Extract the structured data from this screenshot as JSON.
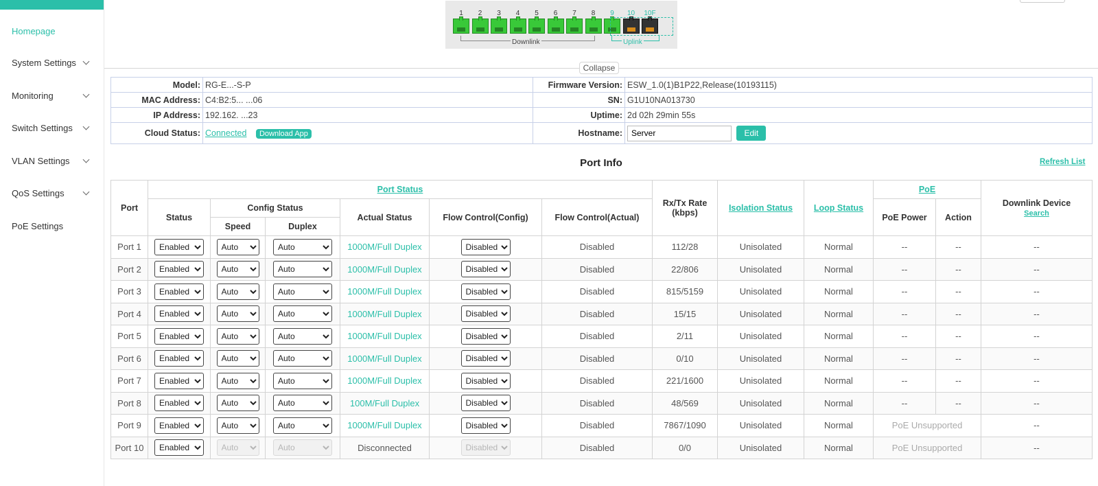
{
  "sidebar": {
    "items": [
      {
        "label": "Homepage",
        "active": true,
        "expandable": false
      },
      {
        "label": "System Settings",
        "expandable": true
      },
      {
        "label": "Monitoring",
        "expandable": true
      },
      {
        "label": "Switch Settings",
        "expandable": true
      },
      {
        "label": "VLAN Settings",
        "expandable": true
      },
      {
        "label": "QoS Settings",
        "expandable": true
      },
      {
        "label": "PoE Settings",
        "expandable": false
      }
    ]
  },
  "panel": {
    "port_numbers": [
      "1",
      "2",
      "3",
      "4",
      "5",
      "6",
      "7",
      "8",
      "9",
      "10",
      "10F"
    ],
    "downlink_label": "Downlink",
    "uplink_label": "Uplink"
  },
  "collapse_label": "Collapse",
  "info": {
    "model_label": "Model:",
    "model_value": "RG-E...-S-P",
    "mac_label": "MAC Address:",
    "mac_value": "C4:B2:5... ...06",
    "ip_label": "IP Address:",
    "ip_value": "192.162. ...23",
    "cloud_label": "Cloud Status:",
    "cloud_value": "Connected",
    "download_app": "Download App",
    "firmware_label": "Firmware Version:",
    "firmware_value": "ESW_1.0(1)B1P22,Release(10193115)",
    "sn_label": "SN:",
    "sn_value": "G1U10NA013730",
    "uptime_label": "Uptime:",
    "uptime_value": "2d 02h 29min 55s",
    "hostname_label": "Hostname:",
    "hostname_value": "Server",
    "edit_label": "Edit"
  },
  "port_info_title": "Port Info",
  "refresh_label": "Refresh List",
  "table": {
    "h_port": "Port",
    "h_port_status": "Port Status",
    "h_status": "Status",
    "h_config_status": "Config Status",
    "h_speed": "Speed",
    "h_duplex": "Duplex",
    "h_actual": "Actual Status",
    "h_flow_config": "Flow Control(Config)",
    "h_flow_actual": "Flow Control(Actual)",
    "h_rate": "Rx/Tx Rate (kbps)",
    "h_isolation": "Isolation Status",
    "h_loop": "Loop Status",
    "h_poe": "PoE",
    "h_poe_power": "PoE Power",
    "h_action": "Action",
    "h_downlink": "Downlink Device",
    "h_search": "Search",
    "rows": [
      {
        "port": "Port 1",
        "status": "Enabled",
        "speed": "Auto",
        "duplex": "Auto",
        "actual": "1000M/Full Duplex",
        "flow_config": "Disabled",
        "flow_actual": "Disabled",
        "rate": "112/28",
        "isolation": "Unisolated",
        "loop": "Normal",
        "poe_power": "--",
        "action": "--",
        "downlink": "--"
      },
      {
        "port": "Port 2",
        "status": "Enabled",
        "speed": "Auto",
        "duplex": "Auto",
        "actual": "1000M/Full Duplex",
        "flow_config": "Disabled",
        "flow_actual": "Disabled",
        "rate": "22/806",
        "isolation": "Unisolated",
        "loop": "Normal",
        "poe_power": "--",
        "action": "--",
        "downlink": "--"
      },
      {
        "port": "Port 3",
        "status": "Enabled",
        "speed": "Auto",
        "duplex": "Auto",
        "actual": "1000M/Full Duplex",
        "flow_config": "Disabled",
        "flow_actual": "Disabled",
        "rate": "815/5159",
        "isolation": "Unisolated",
        "loop": "Normal",
        "poe_power": "--",
        "action": "--",
        "downlink": "--"
      },
      {
        "port": "Port 4",
        "status": "Enabled",
        "speed": "Auto",
        "duplex": "Auto",
        "actual": "1000M/Full Duplex",
        "flow_config": "Disabled",
        "flow_actual": "Disabled",
        "rate": "15/15",
        "isolation": "Unisolated",
        "loop": "Normal",
        "poe_power": "--",
        "action": "--",
        "downlink": "--"
      },
      {
        "port": "Port 5",
        "status": "Enabled",
        "speed": "Auto",
        "duplex": "Auto",
        "actual": "1000M/Full Duplex",
        "flow_config": "Disabled",
        "flow_actual": "Disabled",
        "rate": "2/11",
        "isolation": "Unisolated",
        "loop": "Normal",
        "poe_power": "--",
        "action": "--",
        "downlink": "--"
      },
      {
        "port": "Port 6",
        "status": "Enabled",
        "speed": "Auto",
        "duplex": "Auto",
        "actual": "1000M/Full Duplex",
        "flow_config": "Disabled",
        "flow_actual": "Disabled",
        "rate": "0/10",
        "isolation": "Unisolated",
        "loop": "Normal",
        "poe_power": "--",
        "action": "--",
        "downlink": "--"
      },
      {
        "port": "Port 7",
        "status": "Enabled",
        "speed": "Auto",
        "duplex": "Auto",
        "actual": "1000M/Full Duplex",
        "flow_config": "Disabled",
        "flow_actual": "Disabled",
        "rate": "221/1600",
        "isolation": "Unisolated",
        "loop": "Normal",
        "poe_power": "--",
        "action": "--",
        "downlink": "--"
      },
      {
        "port": "Port 8",
        "status": "Enabled",
        "speed": "Auto",
        "duplex": "Auto",
        "actual": "100M/Full Duplex",
        "flow_config": "Disabled",
        "flow_actual": "Disabled",
        "rate": "48/569",
        "isolation": "Unisolated",
        "loop": "Normal",
        "poe_power": "--",
        "action": "--",
        "downlink": "--"
      },
      {
        "port": "Port 9",
        "status": "Enabled",
        "speed": "Auto",
        "duplex": "Auto",
        "actual": "1000M/Full Duplex",
        "flow_config": "Disabled",
        "flow_actual": "Disabled",
        "rate": "7867/1090",
        "isolation": "Unisolated",
        "loop": "Normal",
        "poe_text": "PoE Unsupported",
        "downlink": "--"
      },
      {
        "port": "Port 10",
        "status": "Enabled",
        "speed": "Auto",
        "duplex": "Auto",
        "actual": "Disconnected",
        "flow_config": "Disabled",
        "flow_actual": "Disabled",
        "rate": "0/0",
        "isolation": "Unisolated",
        "loop": "Normal",
        "poe_text": "PoE Unsupported",
        "downlink": "--",
        "disabled_config": true
      }
    ]
  },
  "colors": {
    "accent": "#2bbfa9",
    "port_up": "#39c939",
    "port_down": "#333333"
  }
}
